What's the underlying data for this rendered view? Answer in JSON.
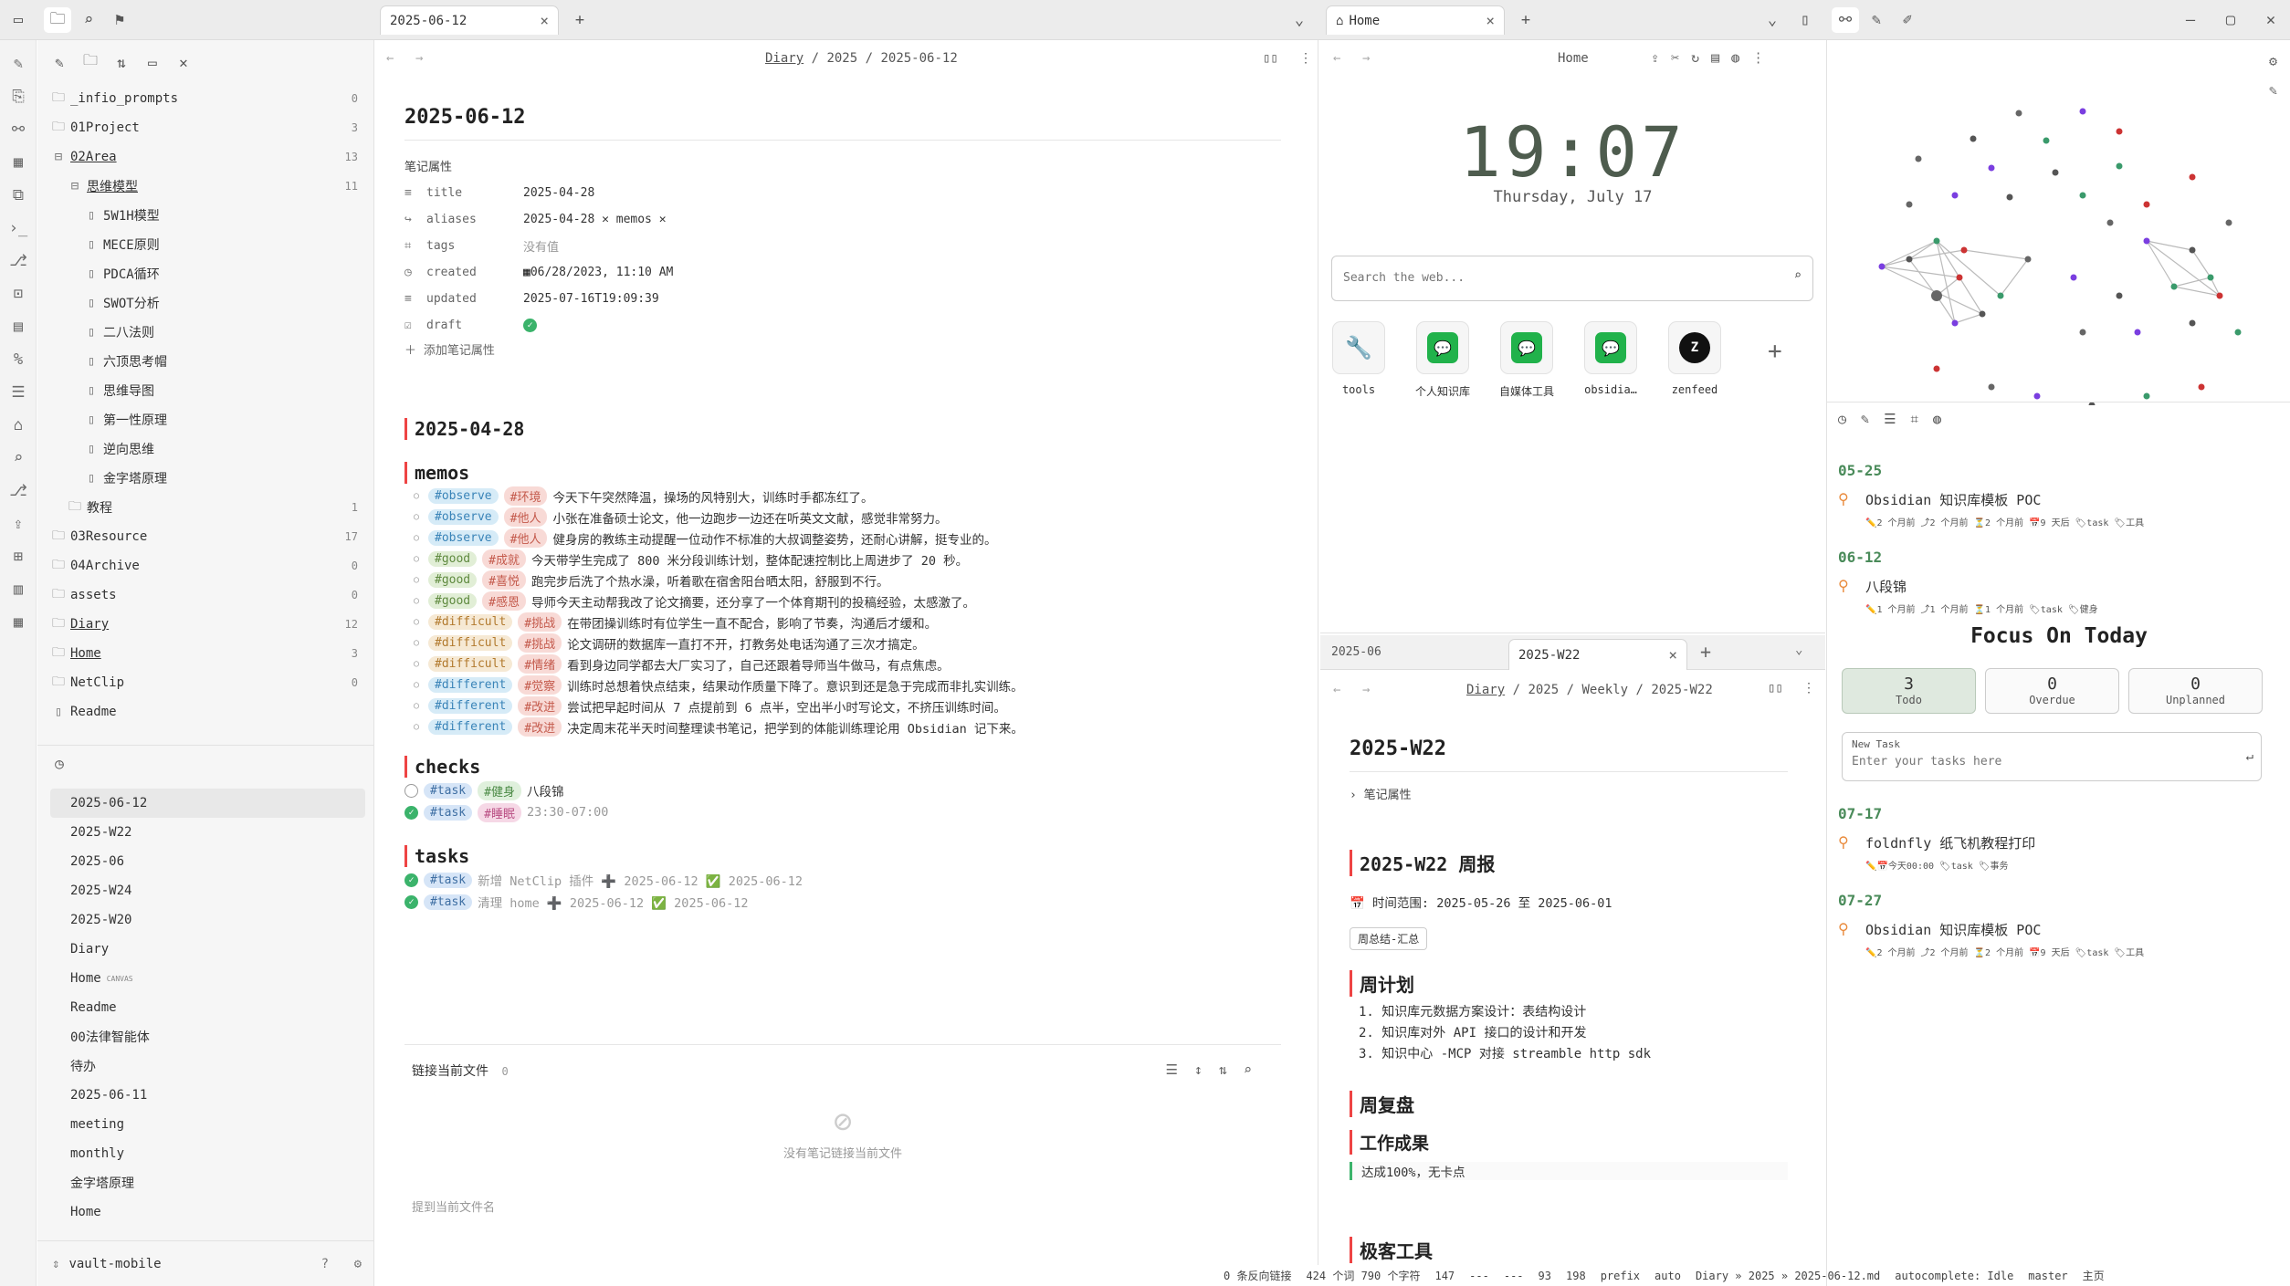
{
  "left_tabs": {
    "active": "2025-06-12"
  },
  "right_tabs": {
    "active": "Home"
  },
  "tree": [
    {
      "name": "_infio_prompts",
      "count": "0",
      "indent": 0,
      "type": "folder"
    },
    {
      "name": "01Project",
      "count": "3",
      "indent": 0,
      "type": "folder"
    },
    {
      "name": "02Area",
      "count": "13",
      "indent": 0,
      "type": "folder-open"
    },
    {
      "name": "思维模型",
      "count": "11",
      "indent": 1,
      "type": "folder-open"
    },
    {
      "name": "5W1H模型",
      "count": "",
      "indent": 2,
      "type": "file"
    },
    {
      "name": "MECE原则",
      "count": "",
      "indent": 2,
      "type": "file"
    },
    {
      "name": "PDCA循环",
      "count": "",
      "indent": 2,
      "type": "file"
    },
    {
      "name": "SWOT分析",
      "count": "",
      "indent": 2,
      "type": "file"
    },
    {
      "name": "二八法则",
      "count": "",
      "indent": 2,
      "type": "file"
    },
    {
      "name": "六顶思考帽",
      "count": "",
      "indent": 2,
      "type": "file"
    },
    {
      "name": "思维导图",
      "count": "",
      "indent": 2,
      "type": "file"
    },
    {
      "name": "第一性原理",
      "count": "",
      "indent": 2,
      "type": "file"
    },
    {
      "name": "逆向思维",
      "count": "",
      "indent": 2,
      "type": "file"
    },
    {
      "name": "金字塔原理",
      "count": "",
      "indent": 2,
      "type": "file"
    },
    {
      "name": "教程",
      "count": "1",
      "indent": 1,
      "type": "folder"
    },
    {
      "name": "03Resource",
      "count": "17",
      "indent": 0,
      "type": "folder"
    },
    {
      "name": "04Archive",
      "count": "0",
      "indent": 0,
      "type": "folder"
    },
    {
      "name": "assets",
      "count": "0",
      "indent": 0,
      "type": "folder"
    },
    {
      "name": "Diary",
      "count": "12",
      "indent": 0,
      "type": "folder"
    },
    {
      "name": "Home",
      "count": "3",
      "indent": 0,
      "type": "folder"
    },
    {
      "name": "NetClip",
      "count": "0",
      "indent": 0,
      "type": "folder"
    },
    {
      "name": "Readme",
      "count": "",
      "indent": 0,
      "type": "file"
    }
  ],
  "recent": [
    "2025-06-12",
    "2025-W22",
    "2025-06",
    "2025-W24",
    "2025-W20",
    "Diary",
    "Home",
    "Readme",
    "00法律智能体",
    "待办",
    "2025-06-11",
    "meeting",
    "monthly",
    "金字塔原理",
    "Home"
  ],
  "recent_badge": "CANVAS",
  "vault_name": "vault-mobile",
  "note": {
    "breadcrumb": [
      "Diary",
      "2025",
      "2025-06-12"
    ],
    "title": "2025-06-12",
    "props_label": "笔记属性",
    "props": [
      {
        "key": "title",
        "value": "2025-04-28"
      },
      {
        "key": "aliases",
        "value": "2025-04-28 ✕ memos ✕"
      },
      {
        "key": "tags",
        "value": "没有值"
      },
      {
        "key": "created",
        "value": "06/28/2023, 11:10 AM"
      },
      {
        "key": "updated",
        "value": "2025-07-16T19:09:39"
      },
      {
        "key": "draft",
        "value": ""
      }
    ],
    "add_prop": "添加笔记属性",
    "h_date": "2025-04-28",
    "h_memos": "memos",
    "memos": [
      {
        "t1": "#observe",
        "t2": "#环境",
        "text": "今天下午突然降温，操场的风特别大，训练时手都冻红了。",
        "c1": "t-obs"
      },
      {
        "t1": "#observe",
        "t2": "#他人",
        "text": "小张在准备硕士论文，他一边跑步一边还在听英文文献，感觉非常努力。",
        "c1": "t-obs"
      },
      {
        "t1": "#observe",
        "t2": "#他人",
        "text": "健身房的教练主动提醒一位动作不标准的大叔调整姿势，还耐心讲解，挺专业的。",
        "c1": "t-obs"
      },
      {
        "t1": "#good",
        "t2": "#成就",
        "text": "今天带学生完成了 800 米分段训练计划，整体配速控制比上周进步了 20 秒。",
        "c1": "t-good"
      },
      {
        "t1": "#good",
        "t2": "#喜悦",
        "text": "跑完步后洗了个热水澡，听着歌在宿舍阳台晒太阳，舒服到不行。",
        "c1": "t-good"
      },
      {
        "t1": "#good",
        "t2": "#感恩",
        "text": "导师今天主动帮我改了论文摘要，还分享了一个体育期刊的投稿经验，太感激了。",
        "c1": "t-good"
      },
      {
        "t1": "#difficult",
        "t2": "#挑战",
        "text": "在带团操训练时有位学生一直不配合，影响了节奏，沟通后才缓和。",
        "c1": "t-diff"
      },
      {
        "t1": "#difficult",
        "t2": "#挑战",
        "text": "论文调研的数据库一直打不开，打教务处电话沟通了三次才搞定。",
        "c1": "t-diff"
      },
      {
        "t1": "#difficult",
        "t2": "#情绪",
        "text": "看到身边同学都去大厂实习了，自己还跟着导师当牛做马，有点焦虑。",
        "c1": "t-diff"
      },
      {
        "t1": "#different",
        "t2": "#觉察",
        "text": "训练时总想着快点结束，结果动作质量下降了。意识到还是急于完成而非扎实训练。",
        "c1": "t-dif2"
      },
      {
        "t1": "#different",
        "t2": "#改进",
        "text": "尝试把早起时间从 7 点提前到 6 点半，空出半小时写论文，不挤压训练时间。",
        "c1": "t-dif2"
      },
      {
        "t1": "#different",
        "t2": "#改进",
        "text": "决定周末花半天时间整理读书笔记，把学到的体能训练理论用 Obsidian 记下来。",
        "c1": "t-dif2"
      }
    ],
    "h_checks": "checks",
    "checks": [
      {
        "tag1": "#task",
        "tag2": "#健身",
        "text": "八段锦",
        "done": false
      },
      {
        "tag1": "#task",
        "tag2": "#睡眠",
        "text": "23:30-07:00",
        "done": true
      }
    ],
    "h_tasks": "tasks",
    "tasks": [
      {
        "text": "新增 NetClip 插件 ➕ 2025-06-12 ✅ 2025-06-12"
      },
      {
        "text": "清理 home ➕ 2025-06-12 ✅ 2025-06-12"
      }
    ],
    "backlinks_title": "链接当前文件",
    "backlinks_count": "0",
    "backlinks_empty": "没有笔记链接当前文件",
    "mentions": "提到当前文件名"
  },
  "home": {
    "title": "Home",
    "time": "19:07",
    "date": "Thursday, July 17",
    "search_placeholder": "Search the web...",
    "links": [
      {
        "label": "tools"
      },
      {
        "label": "个人知识库"
      },
      {
        "label": "自媒体工具"
      },
      {
        "label": "obsidia…"
      },
      {
        "label": "zenfeed"
      }
    ]
  },
  "weekly": {
    "tab_inactive": "2025-06",
    "tab_active": "2025-W22",
    "breadcrumb": [
      "Diary",
      "2025",
      "Weekly",
      "2025-W22"
    ],
    "title": "2025-W22",
    "props_label": "笔记属性",
    "h_report": "2025-W22 周报",
    "range": "📅 时间范围: 2025-05-26 至 2025-06-01",
    "summary_btn": "周总结-汇总",
    "h_plan": "周计划",
    "plan": [
      "知识库元数据方案设计：表结构设计",
      "知识库对外 API 接口的设计和开发",
      "知识中心 -MCP 对接 streamble http sdk"
    ],
    "h_review": "周复盘",
    "h_results": "工作成果",
    "results": "达成100%，无卡点",
    "h_tools": "极客工具"
  },
  "tasks_panel": {
    "groups_top": [
      {
        "date": "05-25",
        "title": "Obsidian 知识库模板 POC",
        "meta": "✏️2 个月前  ⤴2 个月前  ⏳2 个月前  📅9 天后  🏷task  🏷工具"
      },
      {
        "date": "06-12",
        "title": "八段锦",
        "meta": "✏️1 个月前  ⤴1 个月前  ⏳1 个月前  🏷task  🏷健身"
      }
    ],
    "focus_title": "Focus On Today",
    "stats": [
      {
        "n": "3",
        "l": "Todo"
      },
      {
        "n": "0",
        "l": "Overdue"
      },
      {
        "n": "0",
        "l": "Unplanned"
      }
    ],
    "new_task_label": "New Task",
    "new_task_placeholder": "Enter your tasks here",
    "groups_bottom": [
      {
        "date": "07-17",
        "title": "foldnfly 纸飞机教程打印",
        "meta": "✏️📅今天00:00  🏷task  🏷事务"
      },
      {
        "date": "07-27",
        "title": "Obsidian 知识库模板 POC",
        "meta": "✏️2 个月前  ⤴2 个月前  ⏳2 个月前  📅9 天后  🏷task  🏷工具"
      }
    ]
  },
  "status": {
    "backlinks": "0 条反向链接",
    "words": "424 个词 790 个字符",
    "s1": "147",
    "s2": "---",
    "s3": "---",
    "s4": "93",
    "s5": "198",
    "prefix": "prefix",
    "auto": "auto",
    "path": "Diary » 2025 » 2025-06-12.md",
    "autocomplete": "autocomplete: Idle",
    "branch": "master",
    "main": "主页"
  },
  "colors": {
    "accent": "#e44",
    "green": "#4a8b5a",
    "clock": "#4e5c4e"
  }
}
